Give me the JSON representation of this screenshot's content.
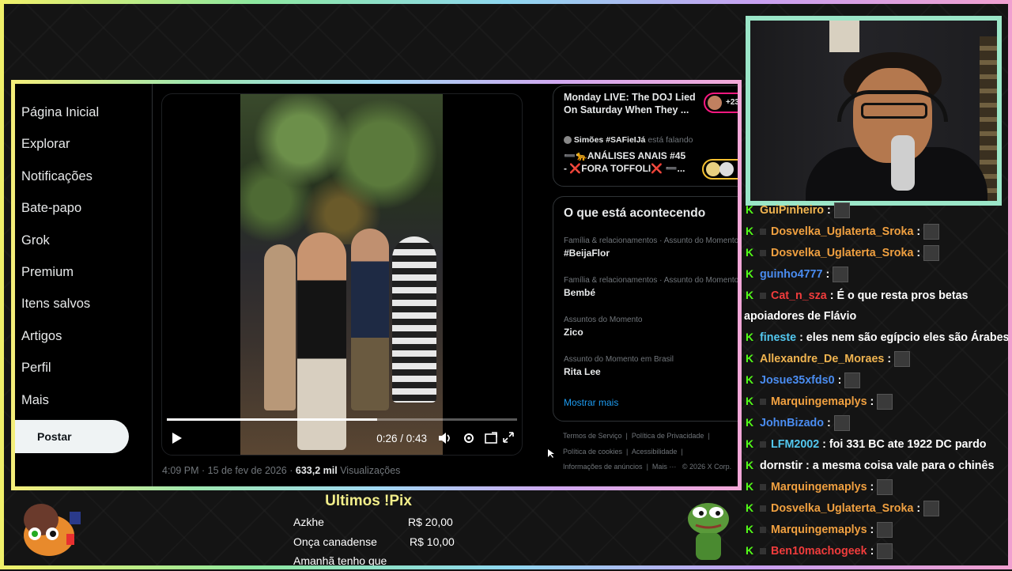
{
  "nav": {
    "items": [
      "Página Inicial",
      "Explorar",
      "Notificações",
      "Bate-papo",
      "Grok",
      "Premium",
      "Itens salvos",
      "Artigos",
      "Perfil",
      "Mais"
    ],
    "post_button": "Postar"
  },
  "player": {
    "time": "0:26 / 0:43",
    "progress": 0.6,
    "meta_time": "4:09 PM · 15 de fev de 2026 ·",
    "views_count": "633,2 mil",
    "views_label": "Visualizações"
  },
  "spaces": {
    "live_title": "Monday LIVE: The DOJ Lied On Saturday When They ...",
    "live_count": "+23",
    "host": "Simões #SAFieIJá",
    "host_status": "está falando",
    "space_title_1": "➖🐆ANÁLISES ANAIS #45",
    "space_title_2": "- ❌FORA TOFFOLI❌ ➖..."
  },
  "trends": {
    "heading": "O que está acontecendo",
    "items": [
      {
        "category": "Família & relacionamentos · Assunto do Momento",
        "name": "#BeijaFlor"
      },
      {
        "category": "Família & relacionamentos · Assunto do Momento",
        "name": "Bembé"
      },
      {
        "category": "Assuntos do Momento",
        "name": "Zico"
      },
      {
        "category": "Assunto do Momento em Brasil",
        "name": "Rita Lee"
      }
    ],
    "show_more": "Mostrar mais"
  },
  "footer": {
    "links": [
      "Termos de Serviço",
      "Política de Privacidade",
      "Política de cookies",
      "Acessibilidade",
      "Informações de anúncios",
      "Mais ···",
      "© 2026 X Corp."
    ]
  },
  "chat": [
    {
      "user": "GuiPinheiro",
      "color": "#f0b450",
      "text": ":",
      "emote": true
    },
    {
      "user": "Dosvelka_Uglaterta_Sroka",
      "color": "#f0a040",
      "text": ":",
      "emote": true
    },
    {
      "user": "Dosvelka_Uglaterta_Sroka",
      "color": "#f0a040",
      "text": ":",
      "emote": true
    },
    {
      "user": "guinho4777",
      "color": "#4a8cf0",
      "text": ":",
      "emote": true
    },
    {
      "user": "Cat_n_sza",
      "color": "#f03c3c",
      "text": ": É o que resta pros betas",
      "emote": false
    },
    {
      "user": "",
      "color": "#ffffff",
      "text": "apoiadores de Flávio",
      "emote": false
    },
    {
      "user": "fineste",
      "color": "#53c8f0",
      "text": ": eles nem são egípcio eles são Árabes",
      "emote": false
    },
    {
      "user": "Allexandre_De_Moraes",
      "color": "#f0b450",
      "text": ":",
      "emote": true
    },
    {
      "user": "Josue35xfds0",
      "color": "#4a8cf0",
      "text": ":",
      "emote": true
    },
    {
      "user": "Marquingemaplys",
      "color": "#f0a040",
      "text": ":",
      "emote": true
    },
    {
      "user": "JohnBizado",
      "color": "#4a8cf0",
      "text": ":",
      "emote": true
    },
    {
      "user": "LFM2002",
      "color": "#53c8f0",
      "text": ": foi 331 BC ate 1922 DC pardo",
      "emote": false
    },
    {
      "user": "dornstir",
      "color": "#ffffff",
      "text": ": a mesma coisa vale para o chinês",
      "emote": false
    },
    {
      "user": "Marquingemaplys",
      "color": "#f0a040",
      "text": ":",
      "emote": true
    },
    {
      "user": "Dosvelka_Uglaterta_Sroka",
      "color": "#f0a040",
      "text": ":",
      "emote": true
    },
    {
      "user": "Marquingemaplys",
      "color": "#f0a040",
      "text": ":",
      "emote": true
    },
    {
      "user": "Ben10machogeek",
      "color": "#f03c3c",
      "text": ":",
      "emote": true
    }
  ],
  "pix": {
    "title": "Ultimos !Pix",
    "rows": [
      {
        "name": "Azkhe",
        "amount": "R$ 20,00"
      },
      {
        "name": "Onça canadense",
        "amount": "R$ 10,00"
      },
      {
        "name": "Amanhã tenho que",
        "amount": ""
      }
    ]
  },
  "colors": {
    "accent_blue": "#1d9bf0",
    "kick_green": "#53fc18",
    "pix_title": "#f2ee8a"
  }
}
